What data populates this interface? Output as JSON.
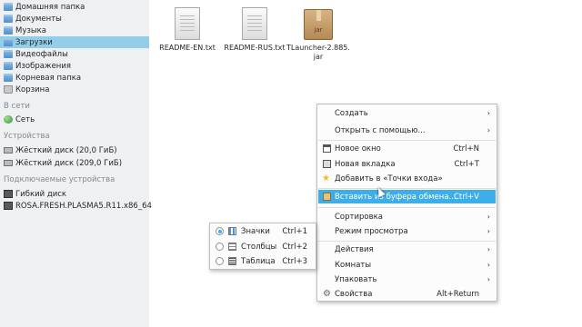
{
  "sidebar": {
    "places": [
      {
        "label": "Домашняя папка",
        "icon": "home-folder-icon"
      },
      {
        "label": "Документы",
        "icon": "documents-folder-icon"
      },
      {
        "label": "Музыка",
        "icon": "music-folder-icon"
      },
      {
        "label": "Загрузки",
        "icon": "downloads-folder-icon",
        "selected": true
      },
      {
        "label": "Видеофайлы",
        "icon": "videos-folder-icon"
      },
      {
        "label": "Изображения",
        "icon": "pictures-folder-icon"
      },
      {
        "label": "Корневая папка",
        "icon": "root-folder-icon"
      },
      {
        "label": "Корзина",
        "icon": "trash-icon"
      }
    ],
    "remote_header": "В сети",
    "remote": [
      {
        "label": "Сеть",
        "icon": "network-icon"
      }
    ],
    "devices_header": "Устройства",
    "devices": [
      {
        "label": "Жёсткий диск (20,0 ГиБ)",
        "icon": "hard-disk-icon"
      },
      {
        "label": "Жёсткий диск (209,0 ГиБ)",
        "icon": "hard-disk-icon"
      }
    ],
    "removable_header": "Подключаемые устройства",
    "removable": [
      {
        "label": "Гибкий диск",
        "icon": "floppy-disk-icon"
      },
      {
        "label": "ROSA.FRESH.PLASMA5.R11.x86_64",
        "icon": "usb-drive-icon"
      }
    ]
  },
  "files": [
    {
      "name": "README-EN.txt",
      "icon": "text-file-icon"
    },
    {
      "name": "README-RUS.txt",
      "icon": "text-file-icon"
    },
    {
      "name": "TLauncher-2.885.\njar",
      "icon": "jar-archive-icon",
      "badge": "jar"
    }
  ],
  "context_menu": {
    "create": "Создать",
    "open_with": "Открыть с помощью...",
    "new_window": "Новое окно",
    "new_window_sc": "Ctrl+N",
    "new_tab": "Новая вкладка",
    "new_tab_sc": "Ctrl+T",
    "add_places": "Добавить в «Точки входа»",
    "paste": "Вставить из буфера обмена...",
    "paste_sc": "Ctrl+V",
    "sort": "Сортировка",
    "view_mode": "Режим просмотра",
    "actions": "Действия",
    "activities": "Комнаты",
    "arrange": "Упаковать",
    "properties": "Свойства",
    "properties_sc": "Alt+Return",
    "arrow": "›"
  },
  "view_submenu": {
    "items": [
      {
        "label": "Значки",
        "shortcut": "Ctrl+1",
        "checked": true
      },
      {
        "label": "Столбцы",
        "shortcut": "Ctrl+2",
        "checked": false
      },
      {
        "label": "Таблица",
        "shortcut": "Ctrl+3",
        "checked": false
      }
    ]
  },
  "colors": {
    "accent": "#3daee9",
    "selection": "#93cee9",
    "sidebar_bg": "#eff0f1"
  }
}
